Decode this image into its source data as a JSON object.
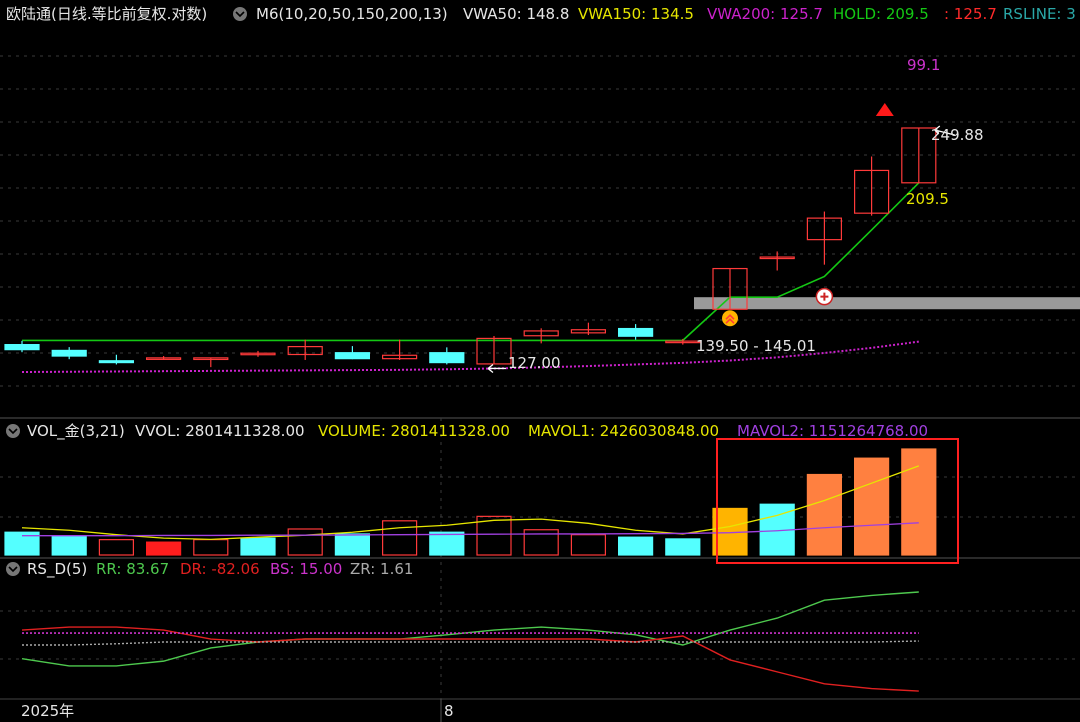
{
  "price_panel": {
    "title": "欧陆通(日线.等比前复权.对数)",
    "indicator": "M6(10,20,50,150,200,13)",
    "vwa50": "VWA50: 148.8",
    "vwa150": "VWA150: 134.5",
    "vwa200": "VWA200: 125.7",
    "hold": "HOLD: 209.5",
    "hold_low": ": 125.7",
    "rsline": "RSLINE: 3",
    "rs_value": "99.1",
    "high_label": "249.88",
    "hold_label": "209.5",
    "low_label": "127.00",
    "zone_label": "139.50 - 145.01"
  },
  "volume_panel": {
    "title": "VOL_金(3,21)",
    "vvol": "VVOL: 2801411328.00",
    "volume": "VOLUME: 2801411328.00",
    "mavol1": "MAVOL1: 2426030848.00",
    "mavol2": "MAVOL2: 1151264768.00"
  },
  "rs_panel": {
    "title": "RS_D(5)",
    "rr": "RR: 83.67",
    "dr": "DR: -82.06",
    "bs": "BS: 15.00",
    "zr": "ZR: 1.61"
  },
  "xaxis": {
    "labels": [
      "2025年",
      "8"
    ]
  },
  "colors": {
    "up": "#ff3a3a",
    "down": "#54ffff",
    "hold": "#14c814",
    "vwa200": "#cc22cc",
    "vol_yellow": "#ffb400",
    "vol_orange": "#ff8040",
    "vol_red": "#ff1e1e",
    "rr": "#4ec94e",
    "dr": "#e02020",
    "bs": "#cc33cc",
    "zr": "#aaaaaa",
    "mavol1": "#e6e600",
    "mavol2": "#a040e0"
  },
  "chart_data": [
    {
      "type": "candlestick",
      "scale": "log",
      "candles": [
        {
          "open": 124.5,
          "high": 126.0,
          "low": 121.5,
          "close": 122.5
        },
        {
          "open": 122.2,
          "high": 123.5,
          "low": 118.8,
          "close": 120.0
        },
        {
          "open": 118.2,
          "high": 120.5,
          "low": 116.8,
          "close": 117.5
        },
        {
          "open": 119.3,
          "high": 120.0,
          "low": 118.5,
          "close": 119.3
        },
        {
          "open": 118.7,
          "high": 119.3,
          "low": 115.8,
          "close": 119.3
        },
        {
          "open": 120.6,
          "high": 122.0,
          "low": 119.7,
          "close": 121.1
        },
        {
          "open": 120.6,
          "high": 126.5,
          "low": 118.5,
          "close": 123.7
        },
        {
          "open": 121.3,
          "high": 123.9,
          "low": 118.8,
          "close": 119.0
        },
        {
          "open": 119.0,
          "high": 126.5,
          "low": 118.5,
          "close": 120.3
        },
        {
          "open": 121.3,
          "high": 123.4,
          "low": 116.8,
          "close": 117.5
        },
        {
          "open": 117.0,
          "high": 128.0,
          "low": 116.8,
          "close": 127.0
        },
        {
          "open": 128.1,
          "high": 131.2,
          "low": 125.0,
          "close": 130.1
        },
        {
          "open": 129.3,
          "high": 133.6,
          "low": 128.4,
          "close": 130.6
        },
        {
          "open": 131.1,
          "high": 133.0,
          "low": 126.5,
          "close": 127.9
        },
        {
          "open": 125.9,
          "high": 126.8,
          "low": 124.5,
          "close": 125.9
        },
        {
          "open": 139.5,
          "high": 159.0,
          "low": 139.5,
          "close": 159.0
        },
        {
          "open": 165.0,
          "high": 168.0,
          "low": 158.0,
          "close": 165.0
        },
        {
          "open": 174.5,
          "high": 191.0,
          "low": 161.0,
          "close": 187.0
        },
        {
          "open": 190.0,
          "high": 228.0,
          "low": 188.5,
          "close": 218.0
        },
        {
          "open": 209.5,
          "high": 249.88,
          "low": 209.5,
          "close": 249.88
        }
      ],
      "hold_line": [
        126.2,
        126.2,
        126.2,
        126.2,
        126.2,
        126.2,
        126.2,
        126.2,
        126.2,
        126.2,
        126.2,
        126.2,
        126.2,
        126.2,
        126.2,
        145.0,
        145.0,
        155.0,
        180.0,
        209.5
      ],
      "vwa200_line": [
        114.0,
        114.1,
        114.2,
        114.3,
        114.4,
        114.5,
        114.6,
        114.7,
        114.8,
        115.0,
        115.3,
        115.7,
        116.2,
        116.8,
        117.4,
        118.3,
        119.5,
        121.2,
        123.2,
        125.7
      ],
      "zone": [
        139.5,
        145.01
      ],
      "buy_marker_index": 15,
      "plus_marker_index": 17,
      "triangle_marker_index": 19
    },
    {
      "type": "bar",
      "series": [
        {
          "name": "VOLUME",
          "values": [
            0.92,
            0.78,
            0.62,
            0.52,
            0.62,
            0.68,
            1.05,
            0.85,
            1.38,
            0.92,
            1.56,
            1.02,
            0.82,
            0.72,
            0.65,
            1.88,
            2.05,
            3.25,
            3.91,
            4.28
          ]
        }
      ],
      "bar_colors": [
        "down",
        "down",
        "up",
        "up_red",
        "up",
        "down",
        "up",
        "down",
        "up",
        "down",
        "up",
        "up",
        "up",
        "down",
        "down",
        "vol_yellow",
        "down",
        "vol_orange",
        "vol_orange",
        "vol_orange"
      ],
      "mavol1": [
        1.1,
        1.0,
        0.82,
        0.68,
        0.63,
        0.72,
        0.8,
        0.92,
        1.1,
        1.2,
        1.4,
        1.45,
        1.28,
        1.0,
        0.85,
        1.15,
        1.6,
        2.2,
        2.9,
        3.6
      ],
      "mavol2": [
        0.78,
        0.78,
        0.78,
        0.79,
        0.79,
        0.8,
        0.8,
        0.81,
        0.82,
        0.83,
        0.84,
        0.85,
        0.85,
        0.86,
        0.87,
        0.9,
        0.98,
        1.1,
        1.2,
        1.3
      ],
      "unit": "x1e9"
    },
    {
      "type": "line",
      "series": [
        {
          "name": "RR",
          "values": [
            -28,
            -40,
            -40,
            -32,
            -10,
            0,
            5,
            5,
            5,
            12,
            20,
            25,
            20,
            12,
            -5,
            20,
            40,
            70,
            78,
            83.67
          ]
        },
        {
          "name": "DR",
          "values": [
            20,
            25,
            25,
            20,
            5,
            0,
            5,
            5,
            5,
            5,
            5,
            5,
            5,
            0,
            10,
            -30,
            -50,
            -70,
            -78,
            -82.06
          ]
        },
        {
          "name": "BS",
          "values": [
            15,
            15,
            15,
            15,
            15,
            15,
            15,
            15,
            15,
            15,
            15,
            15,
            15,
            15,
            15,
            15,
            15,
            15,
            15,
            15
          ]
        },
        {
          "name": "ZR",
          "values": [
            -5,
            -5,
            -3,
            0,
            0,
            0,
            0,
            0,
            0,
            0,
            0,
            0,
            0,
            0,
            0,
            0,
            0,
            0,
            0,
            1.61
          ]
        }
      ],
      "ylim": [
        -100,
        100
      ]
    }
  ]
}
